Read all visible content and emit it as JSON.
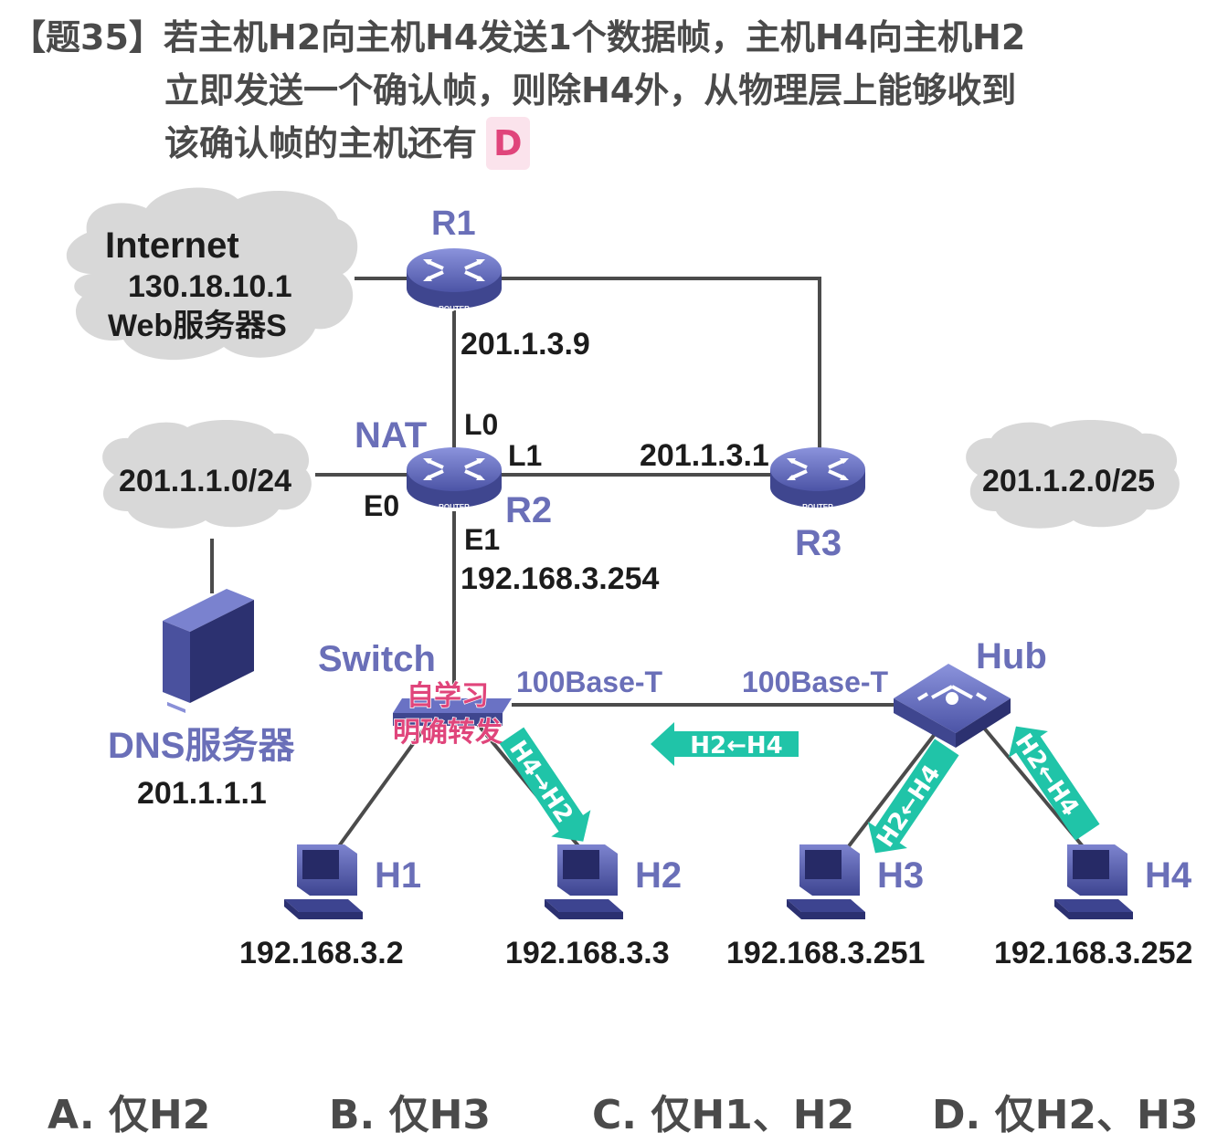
{
  "question": {
    "tag": "【题35】",
    "line1": "若主机H2向主机H4发送1个数据帧，主机H4向主机H2",
    "line2": "立即发送一个确认帧，则除H4外，从物理层上能够收到",
    "line3": "该确认帧的主机还有",
    "answer": "D"
  },
  "clouds": {
    "internet": {
      "title": "Internet",
      "ip": "130.18.10.1",
      "server": "Web服务器S"
    },
    "lan1": {
      "label": "201.1.1.0/24"
    },
    "lan2": {
      "label": "201.1.2.0/25"
    }
  },
  "routers": {
    "r1": {
      "name": "R1",
      "ip": "201.1.3.9"
    },
    "r2": {
      "name": "R2",
      "nat": "NAT",
      "l0": "L0",
      "l1": "L1",
      "e0": "E0",
      "e1": "E1",
      "e1_ip": "192.168.3.254"
    },
    "r3": {
      "name": "R3",
      "ip": "201.1.3.1"
    },
    "icon_text": "ROUTER"
  },
  "dns": {
    "name": "DNS服务器",
    "ip": "201.1.1.1"
  },
  "switch": {
    "name": "Switch",
    "note1": "自学习",
    "note2": "明确转发"
  },
  "hub": {
    "name": "Hub"
  },
  "links": {
    "left": "100Base-T",
    "right": "100Base-T"
  },
  "hosts": [
    {
      "name": "H1",
      "ip": "192.168.3.2"
    },
    {
      "name": "H2",
      "ip": "192.168.3.3"
    },
    {
      "name": "H3",
      "ip": "192.168.3.251"
    },
    {
      "name": "H4",
      "ip": "192.168.3.252"
    }
  ],
  "arrows": {
    "sw_h2": "H4→H2",
    "hub_sw": "H2←H4",
    "hub_h3": "H2←H4",
    "h4_hub": "H2←H4"
  },
  "options": [
    {
      "letter": "A.",
      "text": "仅H2"
    },
    {
      "letter": "B.",
      "text": "仅H3"
    },
    {
      "letter": "C.",
      "text": "仅H1、H2"
    },
    {
      "letter": "D.",
      "text": "仅H2、H3"
    }
  ],
  "colors": {
    "accent": "#20c4a8",
    "router": "#6a72c4",
    "highlight": "#e0457b",
    "label_blue": "#6a6fb8"
  }
}
